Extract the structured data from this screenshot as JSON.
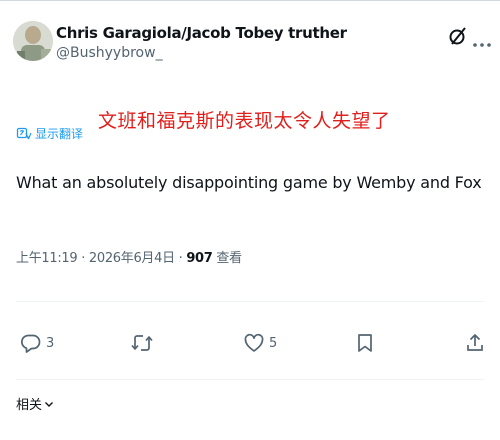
{
  "author": {
    "display_name": "Chris Garagiola/Jacob Tobey truther",
    "handle": "@Bushyybrow_"
  },
  "header_icons": [
    "grok-icon",
    "more-icon"
  ],
  "translation": {
    "translated_text": "文班和福克斯的表现太令人失望了",
    "show_translation_label": "显示翻译",
    "translated_text_color": "#e0201c",
    "link_color": "#1d9bf0"
  },
  "tweet": {
    "text": "What an absolutely disappointing game by Wemby and Fox"
  },
  "meta": {
    "time": "上午11:19",
    "separator1": " · ",
    "date": "2026年6月4日",
    "separator2": " · ",
    "views_count": "907",
    "views_label": " 查看"
  },
  "actions": {
    "replies": "3",
    "retweets": "",
    "likes": "5",
    "icons": [
      "reply-icon",
      "retweet-icon",
      "like-icon",
      "bookmark-icon",
      "share-icon"
    ]
  },
  "related": {
    "label": "相关"
  }
}
